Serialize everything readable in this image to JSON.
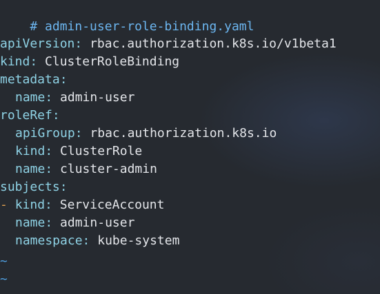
{
  "editor": {
    "comment": "# admin-user-role-binding.yaml",
    "lines": [
      {
        "key": "apiVersion",
        "value": "rbac.authorization.k8s.io/v1beta1"
      },
      {
        "key": "kind",
        "value": "ClusterRoleBinding"
      },
      {
        "key": "metadata",
        "value": ""
      },
      {
        "key": "name",
        "value": "admin-user"
      },
      {
        "key": "roleRef",
        "value": ""
      },
      {
        "key": "apiGroup",
        "value": "rbac.authorization.k8s.io"
      },
      {
        "key": "kind",
        "value": "ClusterRole"
      },
      {
        "key": "name",
        "value": "cluster-admin"
      },
      {
        "key": "subjects",
        "value": ""
      },
      {
        "key": "kind",
        "value": "ServiceAccount"
      },
      {
        "key": "name",
        "value": "admin-user"
      },
      {
        "key": "namespace",
        "value": "kube-system"
      }
    ],
    "list_dash": "-",
    "colon": ":",
    "empty_line_marker": "~"
  },
  "colors": {
    "background": "#262a30",
    "key": "#8fd3e6",
    "value": "#e4e6ea",
    "comment": "#6cb6f0",
    "dash": "#e0a050",
    "tilde": "#4f9fe0"
  }
}
